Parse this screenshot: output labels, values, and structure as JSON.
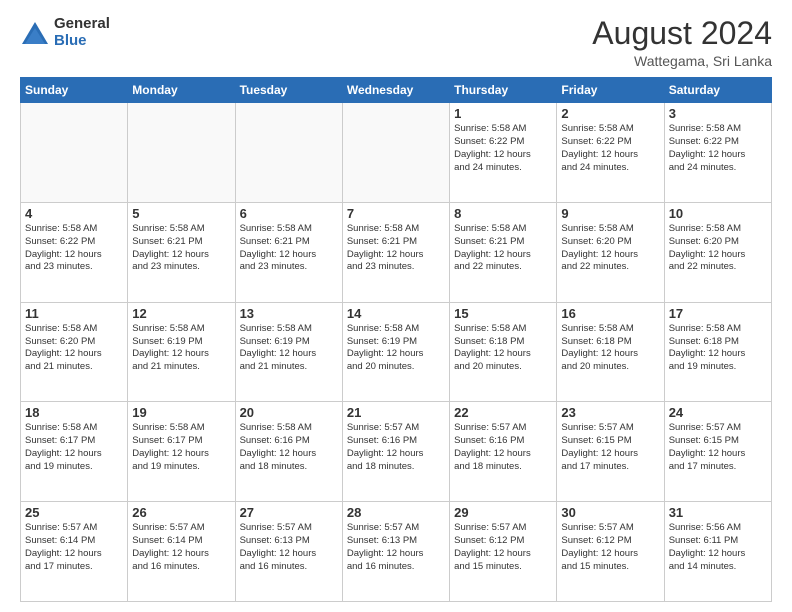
{
  "logo": {
    "general": "General",
    "blue": "Blue"
  },
  "header": {
    "month_year": "August 2024",
    "location": "Wattegama, Sri Lanka"
  },
  "weekdays": [
    "Sunday",
    "Monday",
    "Tuesday",
    "Wednesday",
    "Thursday",
    "Friday",
    "Saturday"
  ],
  "weeks": [
    [
      {
        "day": "",
        "info": ""
      },
      {
        "day": "",
        "info": ""
      },
      {
        "day": "",
        "info": ""
      },
      {
        "day": "",
        "info": ""
      },
      {
        "day": "1",
        "info": "Sunrise: 5:58 AM\nSunset: 6:22 PM\nDaylight: 12 hours\nand 24 minutes."
      },
      {
        "day": "2",
        "info": "Sunrise: 5:58 AM\nSunset: 6:22 PM\nDaylight: 12 hours\nand 24 minutes."
      },
      {
        "day": "3",
        "info": "Sunrise: 5:58 AM\nSunset: 6:22 PM\nDaylight: 12 hours\nand 24 minutes."
      }
    ],
    [
      {
        "day": "4",
        "info": "Sunrise: 5:58 AM\nSunset: 6:22 PM\nDaylight: 12 hours\nand 23 minutes."
      },
      {
        "day": "5",
        "info": "Sunrise: 5:58 AM\nSunset: 6:21 PM\nDaylight: 12 hours\nand 23 minutes."
      },
      {
        "day": "6",
        "info": "Sunrise: 5:58 AM\nSunset: 6:21 PM\nDaylight: 12 hours\nand 23 minutes."
      },
      {
        "day": "7",
        "info": "Sunrise: 5:58 AM\nSunset: 6:21 PM\nDaylight: 12 hours\nand 23 minutes."
      },
      {
        "day": "8",
        "info": "Sunrise: 5:58 AM\nSunset: 6:21 PM\nDaylight: 12 hours\nand 22 minutes."
      },
      {
        "day": "9",
        "info": "Sunrise: 5:58 AM\nSunset: 6:20 PM\nDaylight: 12 hours\nand 22 minutes."
      },
      {
        "day": "10",
        "info": "Sunrise: 5:58 AM\nSunset: 6:20 PM\nDaylight: 12 hours\nand 22 minutes."
      }
    ],
    [
      {
        "day": "11",
        "info": "Sunrise: 5:58 AM\nSunset: 6:20 PM\nDaylight: 12 hours\nand 21 minutes."
      },
      {
        "day": "12",
        "info": "Sunrise: 5:58 AM\nSunset: 6:19 PM\nDaylight: 12 hours\nand 21 minutes."
      },
      {
        "day": "13",
        "info": "Sunrise: 5:58 AM\nSunset: 6:19 PM\nDaylight: 12 hours\nand 21 minutes."
      },
      {
        "day": "14",
        "info": "Sunrise: 5:58 AM\nSunset: 6:19 PM\nDaylight: 12 hours\nand 20 minutes."
      },
      {
        "day": "15",
        "info": "Sunrise: 5:58 AM\nSunset: 6:18 PM\nDaylight: 12 hours\nand 20 minutes."
      },
      {
        "day": "16",
        "info": "Sunrise: 5:58 AM\nSunset: 6:18 PM\nDaylight: 12 hours\nand 20 minutes."
      },
      {
        "day": "17",
        "info": "Sunrise: 5:58 AM\nSunset: 6:18 PM\nDaylight: 12 hours\nand 19 minutes."
      }
    ],
    [
      {
        "day": "18",
        "info": "Sunrise: 5:58 AM\nSunset: 6:17 PM\nDaylight: 12 hours\nand 19 minutes."
      },
      {
        "day": "19",
        "info": "Sunrise: 5:58 AM\nSunset: 6:17 PM\nDaylight: 12 hours\nand 19 minutes."
      },
      {
        "day": "20",
        "info": "Sunrise: 5:58 AM\nSunset: 6:16 PM\nDaylight: 12 hours\nand 18 minutes."
      },
      {
        "day": "21",
        "info": "Sunrise: 5:57 AM\nSunset: 6:16 PM\nDaylight: 12 hours\nand 18 minutes."
      },
      {
        "day": "22",
        "info": "Sunrise: 5:57 AM\nSunset: 6:16 PM\nDaylight: 12 hours\nand 18 minutes."
      },
      {
        "day": "23",
        "info": "Sunrise: 5:57 AM\nSunset: 6:15 PM\nDaylight: 12 hours\nand 17 minutes."
      },
      {
        "day": "24",
        "info": "Sunrise: 5:57 AM\nSunset: 6:15 PM\nDaylight: 12 hours\nand 17 minutes."
      }
    ],
    [
      {
        "day": "25",
        "info": "Sunrise: 5:57 AM\nSunset: 6:14 PM\nDaylight: 12 hours\nand 17 minutes."
      },
      {
        "day": "26",
        "info": "Sunrise: 5:57 AM\nSunset: 6:14 PM\nDaylight: 12 hours\nand 16 minutes."
      },
      {
        "day": "27",
        "info": "Sunrise: 5:57 AM\nSunset: 6:13 PM\nDaylight: 12 hours\nand 16 minutes."
      },
      {
        "day": "28",
        "info": "Sunrise: 5:57 AM\nSunset: 6:13 PM\nDaylight: 12 hours\nand 16 minutes."
      },
      {
        "day": "29",
        "info": "Sunrise: 5:57 AM\nSunset: 6:12 PM\nDaylight: 12 hours\nand 15 minutes."
      },
      {
        "day": "30",
        "info": "Sunrise: 5:57 AM\nSunset: 6:12 PM\nDaylight: 12 hours\nand 15 minutes."
      },
      {
        "day": "31",
        "info": "Sunrise: 5:56 AM\nSunset: 6:11 PM\nDaylight: 12 hours\nand 14 minutes."
      }
    ]
  ]
}
